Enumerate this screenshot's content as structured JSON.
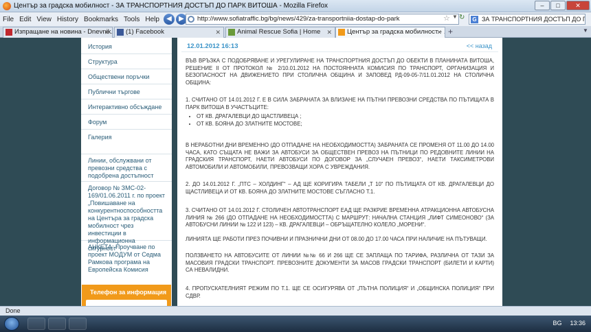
{
  "window": {
    "title": "Център за градска мобилност - ЗА ТРАНСПОРТНИЯ ДОСТЪП ДО ПАРК ВИТОША - Mozilla Firefox",
    "min_label": "–",
    "max_label": "□",
    "close_label": "✕"
  },
  "menu": {
    "items": [
      "File",
      "Edit",
      "View",
      "History",
      "Bookmarks",
      "Tools",
      "Help"
    ]
  },
  "nav": {
    "back_icon": "◀",
    "forward_icon": "▶",
    "url": "http://www.sofiatraffic.bg/bg/news/429/za-transportniia-dostap-do-park",
    "star_icon": "☆",
    "dropdown_icon": "▼",
    "reload_icon": "↻",
    "search_value": "ЗА ТРАНСПОРТНИЯ ДОСТЪП ДО ПАР",
    "search_engine": "G"
  },
  "tabs": [
    {
      "label": "Изпращане на новина - Dnevnik.bg",
      "active": false
    },
    {
      "label": "(1) Facebook",
      "active": false
    },
    {
      "label": "Animal Rescue Sofia | Home",
      "active": false
    },
    {
      "label": "Център за градска мобилност - ...",
      "active": true
    }
  ],
  "tab_close_icon": "✕",
  "new_tab_icon": "+",
  "tab_list_icon": "▼",
  "sidebar": {
    "items": [
      "История",
      "Структура",
      "Обществени поръчки",
      "Публични търгове",
      "Интерактивно обсъждане",
      "Форум",
      "Галерия",
      "Линии, обслужвани от превозни средства с подобрена достъпност",
      "Договор № ЗМС-02-169/01.06.2011 г. по проект „Повишаване на конкурентноспособността на Центъра за градска мобилност чрез инвестиции в информационна сигурност“",
      "АНКЕТА: Проучване по проект МОДУМ от Седма Рамкова програма на Европейска Комисия"
    ],
    "phone_title": "Телефон за информация"
  },
  "article": {
    "date": "12.01.2012 16:13",
    "back_label": "<< назад",
    "intro": "ВЪВ ВРЪЗКА С ПОДОБРЯВАНЕ И УРЕГУЛИРАНЕ НА ТРАНСПОРТНИЯ ДОСТЪП ДО ОБЕКТИ В ПЛАНИНАТА ВИТОША, РЕШЕНИЕ II ОТ ПРОТОКОЛ № 2/10.01.2012 НА ПОСТОЯННАТА КОМИСИЯ ПО ТРАНСПОРТ, ОРГАНИЗАЦИЯ И БЕЗОПАСНОСТ НА ДВИЖЕНИЕТО ПРИ СТОЛИЧНА ОБЩИНА И ЗАПОВЕД РД-09-05-7/11.01.2012 НА СТОЛИЧНА ОБЩИНА:",
    "p1": "1. СЧИТАНО ОТ 14.01.2012 Г. Е В СИЛА ЗАБРАНАТА ЗА ВЛИЗАНЕ НА ПЪТНИ ПРЕВОЗНИ СРЕДСТВА ПО ПЪТИЩАТА В ПАРК ВИТОША В УЧАСТЪЦИТЕ:",
    "bullets": [
      "ОТ КВ. ДРАГАЛЕВЦИ ДО ЩАСТЛИВЕЦА ;",
      "ОТ КВ. БОЯНА ДО ЗЛАТНИТЕ МОСТОВЕ;"
    ],
    "p2": "В НЕРАБОТНИ ДНИ ВРЕМЕННО (ДО ОТПАДАНЕ НА НЕОБХОДИМОСТТА) ЗАБРАНАТА СЕ ПРОМЕНЯ ОТ 11.00 ДО 14.00 ЧАСА, КАТО СЪЩАТА НЕ ВАЖИ ЗА АВТОБУСИ ЗА ОБЩЕСТВЕН ПРЕВОЗ НА ПЪТНИЦИ ПО РЕДОВНИТЕ ЛИНИИ НА ГРАДСКИЯ ТРАНСПОРТ, НАЕТИ АВТОБУСИ ПО ДОГОВОР ЗА „СЛУЧАЕН ПРЕВОЗ“, НАЕТИ ТАКСИМЕТРОВИ АВТОМОБИЛИ И АВТОМОБИЛИ, ПРЕВОЗВАЩИ ХОРА С УВРЕЖДАНИЯ.",
    "p3": "2. ДО 14.01.2012 Г. „ПТС – ХОЛДИНГ“ – АД ЩЕ КОРИГИРА ТАБЕЛИ „Т 10“ ПО ПЪТИЩАТА ОТ КВ. ДРАГАЛЕВЦИ ДО ЩАСТЛИВЕЦА И ОТ КВ. БОЯНА ДО ЗЛАТНИТЕ МОСТОВЕ СЪГЛАСНО Т.1.",
    "p4": "3. СЧИТАНО ОТ 14.01.2012 Г. СТОЛИЧЕН АВТОТРАНСПОРТ ЕАД ЩЕ РАЗКРИЕ ВРЕМЕННА АТРАКЦИОННА АВТОБУСНА ЛИНИЯ № 266 (ДО ОТПАДАНЕ НА НЕОБХОДИМОСТТА) С МАРШРУТ: НАЧАЛНА СТАНЦИЯ „ЛИФТ СИМЕОНОВО“ (ЗА АВТОБУСНИ ЛИНИИ № 122 И 123) – КВ. ДРАГАЛЕВЦИ – ОБРЪЩАТЕЛНО КОЛЕЛО „МОРЕНИ“.",
    "p5": "ЛИНИЯТА ЩЕ РАБОТИ ПРЕЗ ПОЧИВНИ И ПРАЗНИЧНИ ДНИ ОТ 08.00 ДО 17.00 ЧАСА ПРИ НАЛИЧИЕ НА ПЪТУВАЩИ.",
    "p6": "ПОЛЗВАНЕТО НА АВТОБУСИТЕ ОТ ЛИНИИ №№ 66 И 266 ЩЕ СЕ ЗАПЛАЩА ПО ТАРИФА, РАЗЛИЧНА ОТ ТАЗИ ЗА МАСОВИЯ ГРАДСКИ ТРАНСПОРТ. ПРЕВОЗНИТЕ ДОКУМЕНТИ ЗА МАСОВ ГРАДСКИ ТРАНСПОРТ (БИЛЕТИ И КАРТИ) СА НЕВАЛИДНИ.",
    "p7": "4. ПРОПУСКАТЕЛНИЯТ РЕЖИМ ПО Т.1. ЩЕ СЕ ОСИГУРЯВА ОТ „ПЪТНА ПОЛИЦИЯ“ И „ОБЩИНСКА ПОЛИЦИЯ“ ПРИ СДВР."
  },
  "status": "Done",
  "taskbar": {
    "lang": "BG",
    "clock": "13:36"
  }
}
